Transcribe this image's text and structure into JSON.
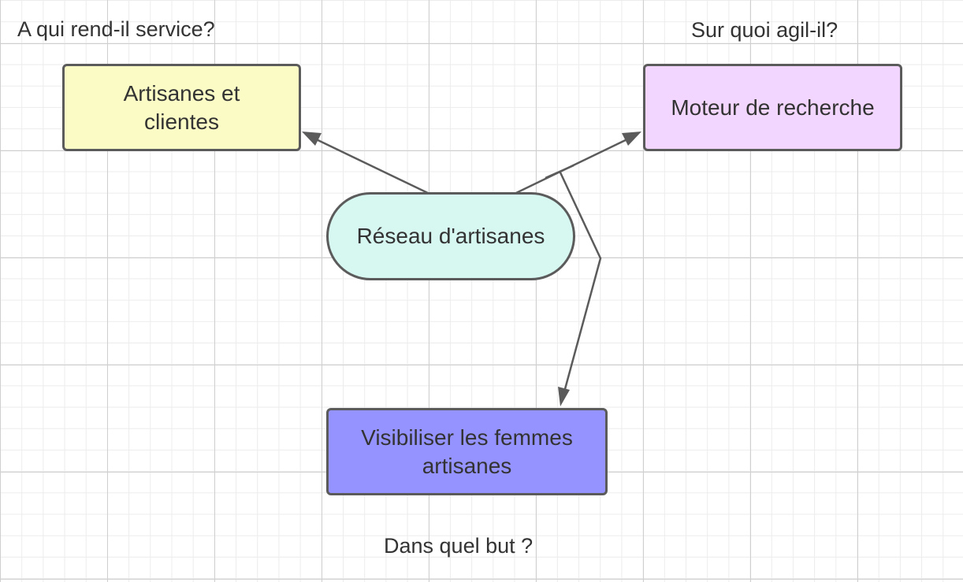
{
  "questions": {
    "who": "A qui rend-il service?",
    "on_what": "Sur quoi agil-il?",
    "purpose": "Dans quel but ?"
  },
  "nodes": {
    "center": "Réseau d'artisanes",
    "left": "Artisanes et clientes",
    "right": "Moteur de recherche",
    "bottom": "Visibiliser les femmes artisanes"
  },
  "colors": {
    "left_fill": "#fbfbc6",
    "right_fill": "#f3d6ff",
    "center_fill": "#d7f7f1",
    "bottom_fill": "#9593ff",
    "stroke": "#5b5b5b"
  }
}
